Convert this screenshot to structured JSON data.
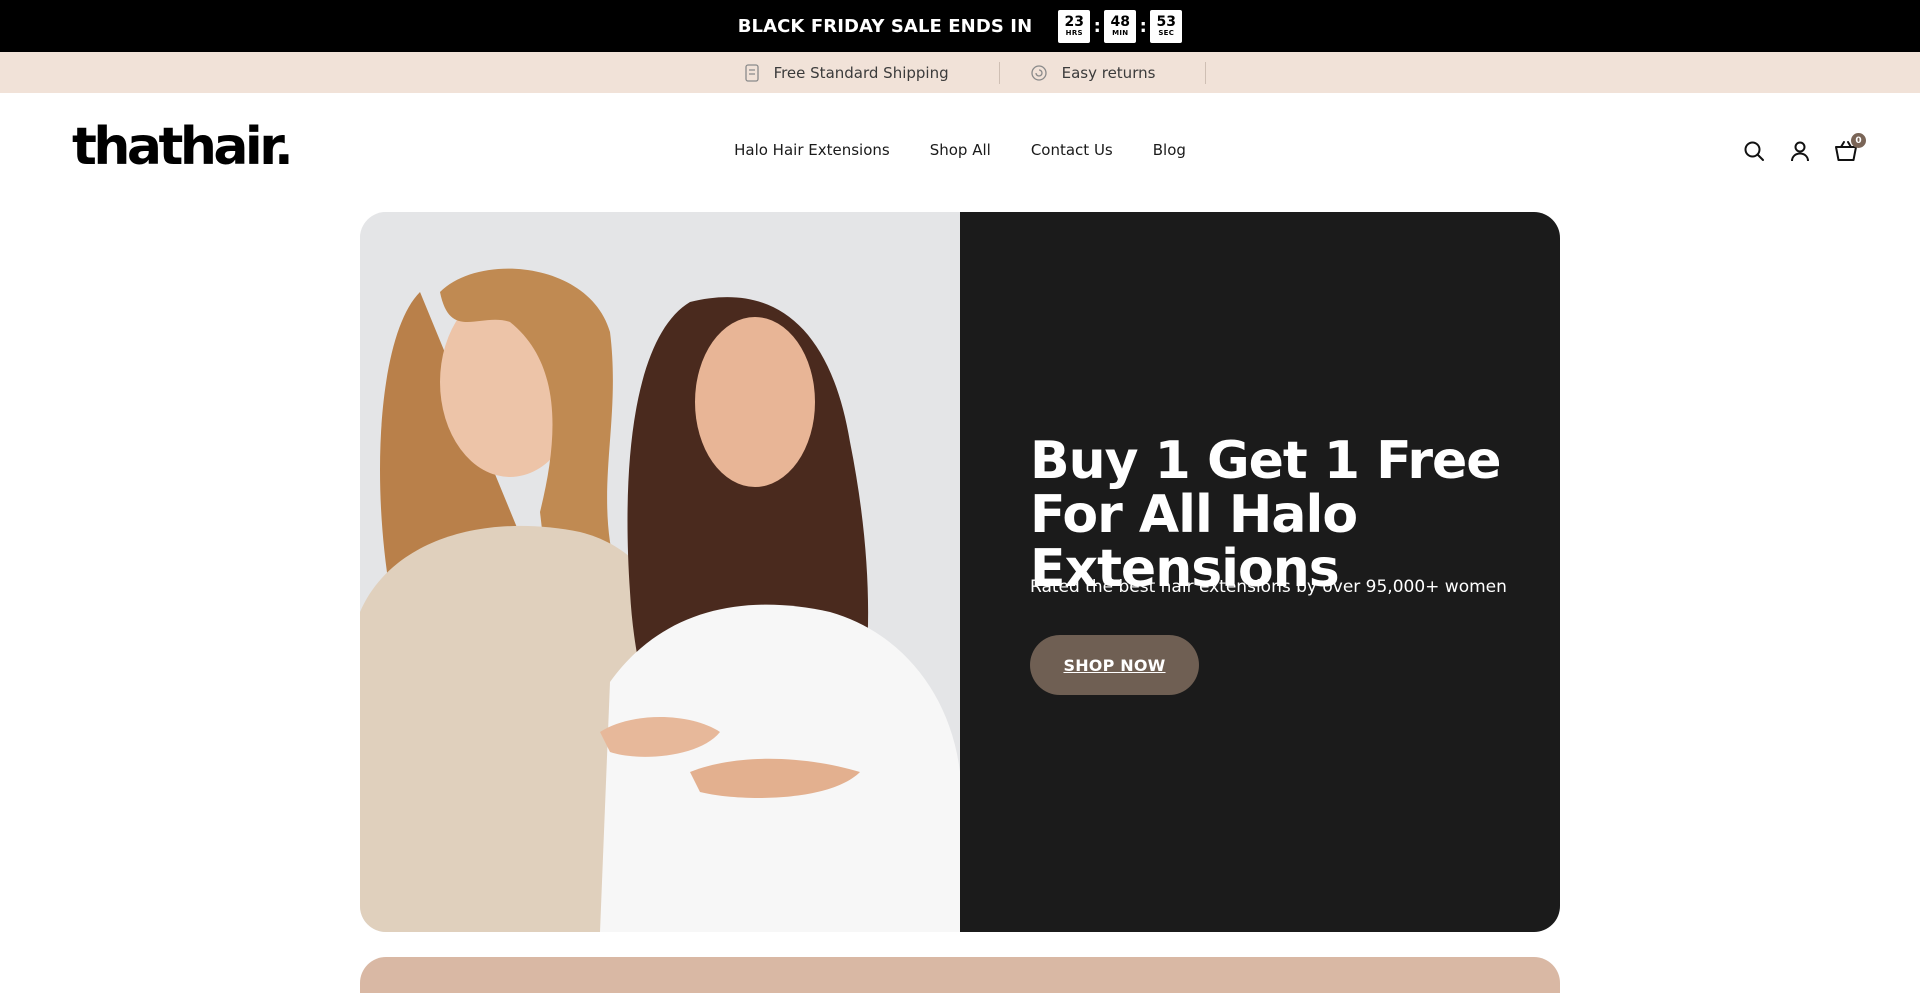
{
  "promo": {
    "title": "BLACK FRIDAY SALE ENDS IN",
    "timer": [
      {
        "value": "23",
        "label": "HRS"
      },
      {
        "value": "48",
        "label": "MIN"
      },
      {
        "value": "53",
        "label": "SEC"
      }
    ],
    "separator": ":"
  },
  "usp": {
    "items": [
      {
        "label": "Free Standard Shipping",
        "icon": "shipping-box-icon"
      },
      {
        "label": "Easy returns",
        "icon": "returns-icon"
      }
    ]
  },
  "header": {
    "logo": "thathair.",
    "nav": [
      "Halo Hair Extensions",
      "Shop All",
      "Contact Us",
      "Blog"
    ],
    "cart_count": "0",
    "icons": [
      "search-icon",
      "account-icon",
      "cart-icon"
    ]
  },
  "hero": {
    "title": "Buy 1 Get 1 Free For All Halo Extensions",
    "subtitle": "Rated the best hair extensions by over 95,000+ women",
    "button": "SHOP NOW"
  },
  "colors": {
    "promo_bg": "#000000",
    "usp_bg": "#f1e2d8",
    "hero_bg": "#1b1b1b",
    "button_bg": "#6f5f53",
    "next_section_bg": "#d9b8a4"
  }
}
